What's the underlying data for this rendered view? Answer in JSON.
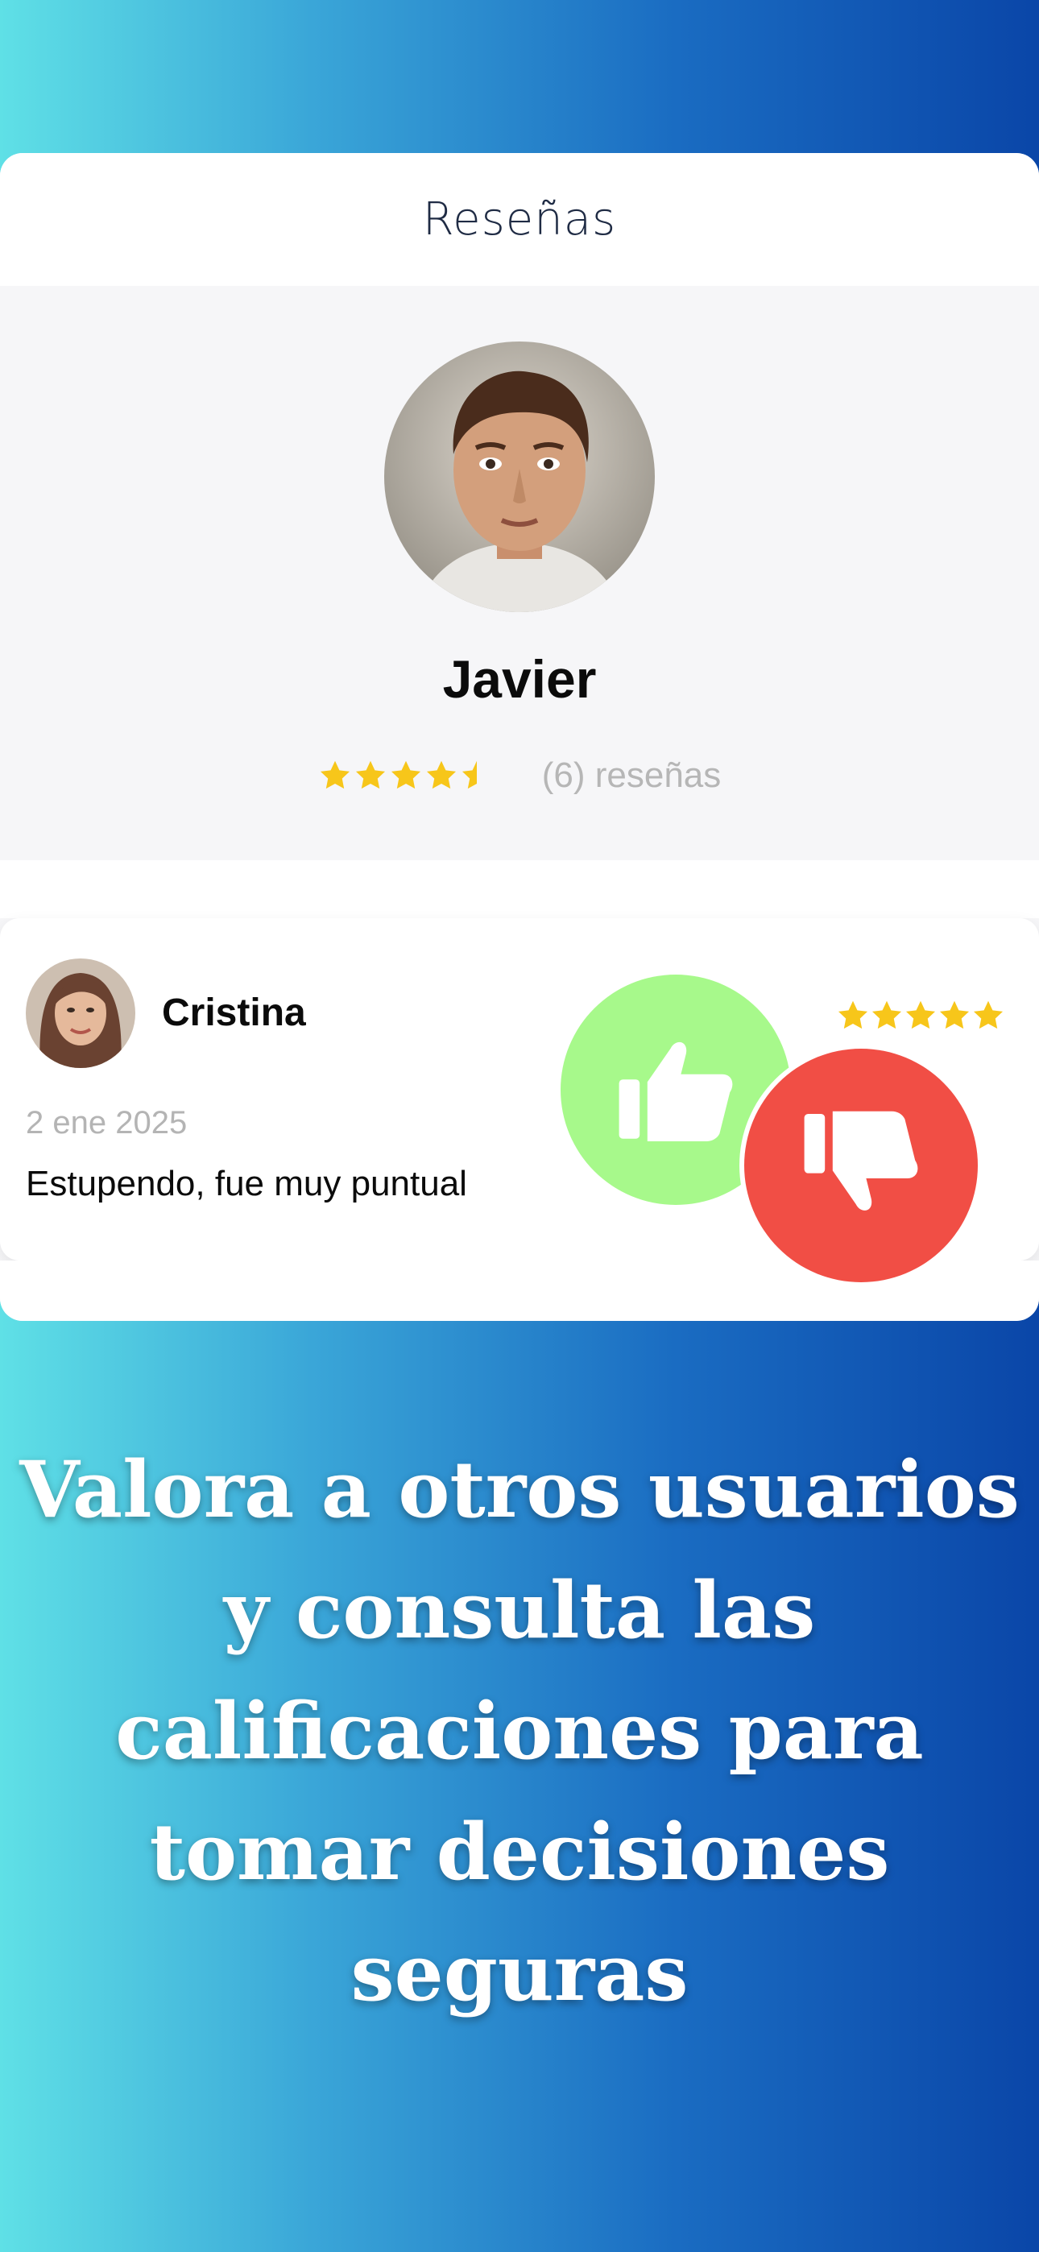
{
  "header": {
    "title": "Reseñas"
  },
  "profile": {
    "name": "Javier",
    "rating": 4.5,
    "rating_max": 5,
    "review_count_text": "(6) reseñas",
    "avatar_icon": "man-portrait-avatar"
  },
  "review": {
    "reviewer_name": "Cristina",
    "reviewer_avatar_icon": "woman-portrait-avatar",
    "rating": 5,
    "date": "2 ene 2025",
    "text": "Estupendo, fue muy puntual"
  },
  "actions": {
    "thumbs_up_icon": "thumbs-up-icon",
    "thumbs_down_icon": "thumbs-down-icon",
    "like_color": "#a7f98b",
    "dislike_color": "#f14e45"
  },
  "colors": {
    "star": "#f7c61a"
  },
  "tagline": "Valora a otros usuarios y consulta las calificaciones para tomar decisiones seguras"
}
